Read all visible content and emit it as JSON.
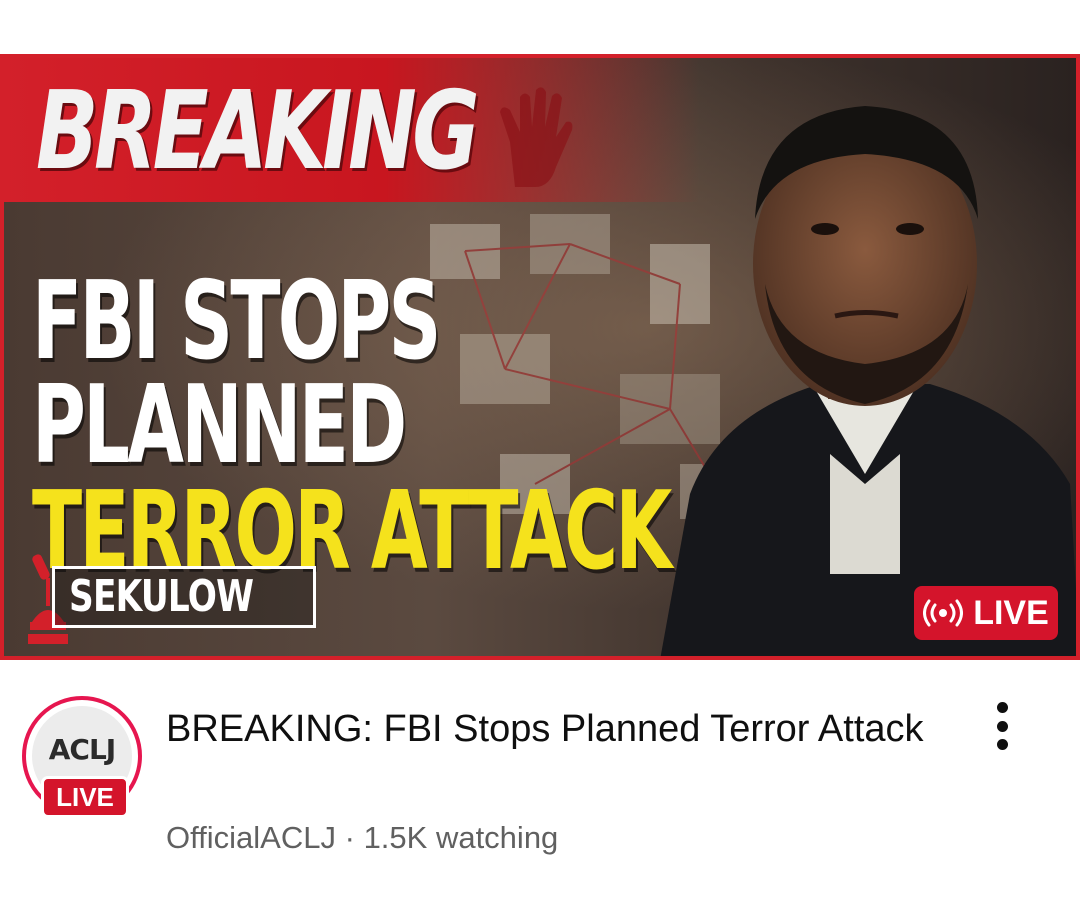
{
  "thumbnail": {
    "breaking_text": "BREAKING",
    "headline_line1": "FBI STOPS",
    "headline_line2": "PLANNED",
    "headline_line3": "TERROR ATTACK",
    "logo_text": "SEKULOW",
    "live_badge_label": "LIVE",
    "live_icon": "broadcast-icon",
    "accent_red": "#d3202a",
    "headline_yellow": "#f5e21c"
  },
  "video": {
    "title": "BREAKING: FBI Stops Planned Terror Attack",
    "channel": "OfficialACLJ",
    "separator": " · ",
    "watching": "1.5K watching",
    "more_icon": "more-vert-icon"
  },
  "channel_avatar": {
    "label": "ACLJ",
    "live_label": "LIVE",
    "ring_color": "#e6164f"
  }
}
